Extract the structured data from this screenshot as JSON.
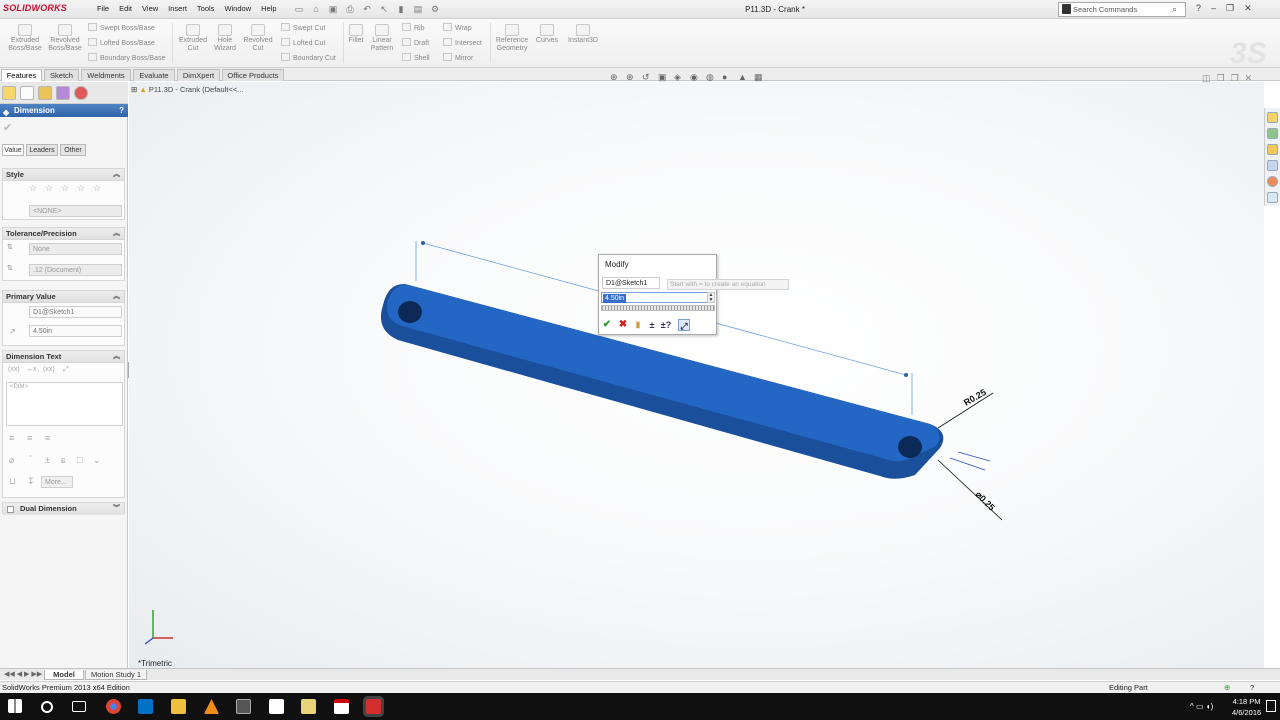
{
  "app": {
    "logo": "SOLIDWORKS",
    "doc_title": "P11.3D - Crank *"
  },
  "menu": [
    "File",
    "Edit",
    "View",
    "Insert",
    "Tools",
    "Window",
    "Help"
  ],
  "search": {
    "placeholder": "Search Commands"
  },
  "ribbon": {
    "extruded_boss": "Extruded Boss/Base",
    "revolved_boss": "Revolved Boss/Base",
    "swept_boss": "Swept Boss/Base",
    "lofted_boss": "Lofted Boss/Base",
    "boundary_boss": "Boundary Boss/Base",
    "extruded_cut": "Extruded Cut",
    "hole_wizard": "Hole Wizard",
    "revolved_cut": "Revolved Cut",
    "swept_cut": "Swept Cut",
    "lofted_cut": "Lofted Cut",
    "boundary_cut": "Boundary Cut",
    "fillet": "Fillet",
    "linear_pattern": "Linear Pattern",
    "rib": "Rib",
    "draft": "Draft",
    "shell": "Shell",
    "wrap": "Wrap",
    "intersect": "Intersect",
    "mirror": "Mirror",
    "reference_geometry": "Reference Geometry",
    "curves": "Curves",
    "instant3d": "Instant3D"
  },
  "tabs": [
    "Features",
    "Sketch",
    "Weldments",
    "Evaluate",
    "DimXpert",
    "Office Products"
  ],
  "property_manager": {
    "title": "Dimension",
    "help": "?",
    "subtabs": [
      "Value",
      "Leaders",
      "Other"
    ],
    "style": {
      "title": "Style",
      "select": "<NONE>"
    },
    "tolerance": {
      "title": "Tolerance/Precision",
      "type": "None",
      "precision": ".12 (Document)"
    },
    "primary_value": {
      "title": "Primary Value",
      "name": "D1@Sketch1",
      "value": "4.50in"
    },
    "dimension_text": {
      "title": "Dimension Text",
      "text": "<DIM>",
      "more": "More..."
    },
    "dual_dimension": "Dual Dimension"
  },
  "viewport": {
    "tree_item": "P11.3D - Crank  (Default<<...",
    "view_name": "*Trimetric",
    "dim_radius": "R0.25",
    "dim_diameter": "⌀0.25"
  },
  "modify": {
    "title": "Modify",
    "dim_name": "D1@Sketch1",
    "value": "4.50in",
    "hint": "Start with = to create an equation"
  },
  "bottom_tabs": [
    "Model",
    "Motion Study 1"
  ],
  "status": {
    "left": "SolidWorks Premium 2013 x64 Edition",
    "right": "Editing Part"
  },
  "taskbar": {
    "time": "4:18 PM",
    "date": "4/6/2016"
  },
  "colors": {
    "part_blue": "#1e5fb8",
    "header_blue": "#2f63a8"
  }
}
